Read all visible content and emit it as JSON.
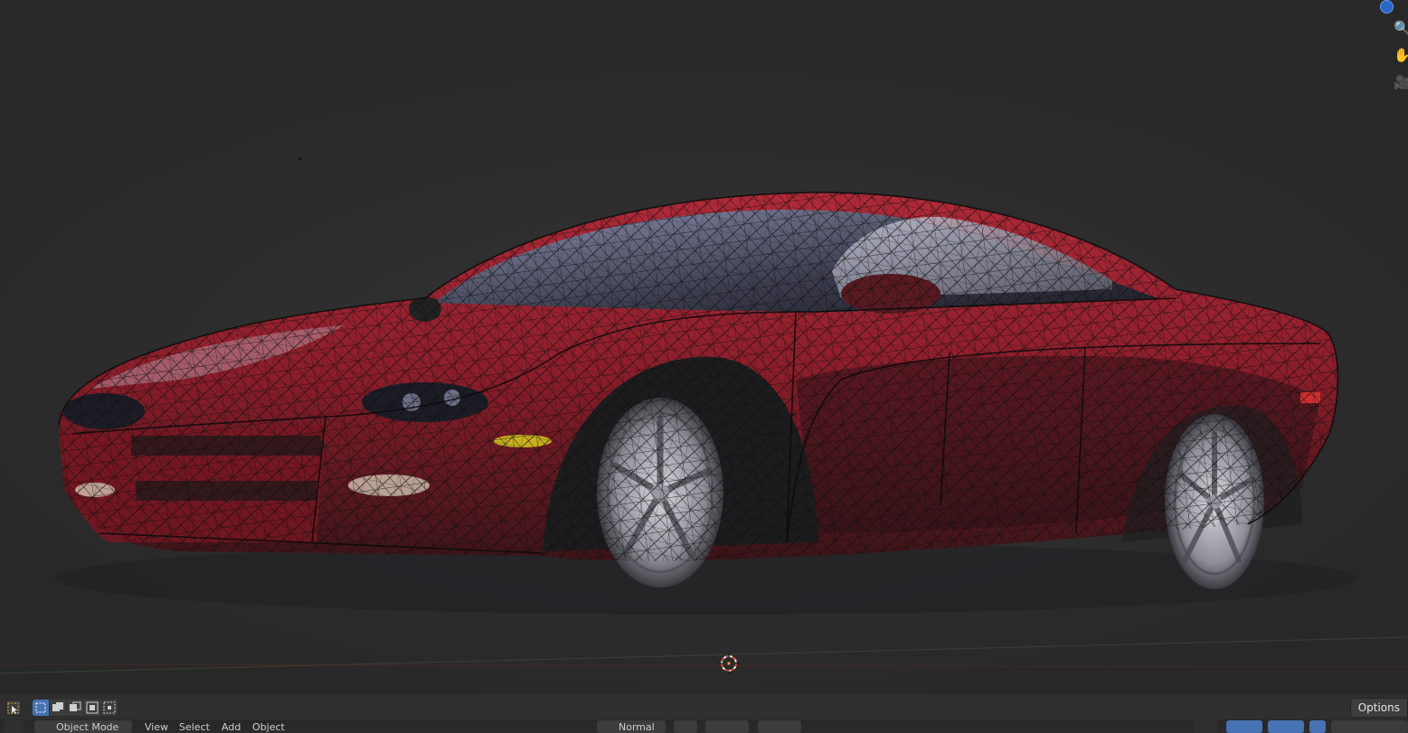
{
  "viewport": {
    "navigation": {
      "axis_icon": "z-axis-dot-icon",
      "zoom_icon": "zoom-icon",
      "pan_icon": "hand-pan-icon",
      "camera_icon": "camera-view-icon"
    },
    "car_body_color": "#a02230",
    "wire_color": "#0c0c0c"
  },
  "toolbar": {
    "options_label": "Options",
    "select_tool_icon": "cursor-select-icon",
    "selection_modes": [
      "select-new-icon",
      "select-extend-icon",
      "select-subtract-icon",
      "select-invert-icon",
      "select-intersect-icon"
    ]
  },
  "header": {
    "mode_label": "Object Mode",
    "menus": [
      "View",
      "Select",
      "Add",
      "Object"
    ],
    "orientation_label": "Normal"
  },
  "colors": {
    "accent": "#4772b3",
    "panel": "#2f2f2f"
  }
}
